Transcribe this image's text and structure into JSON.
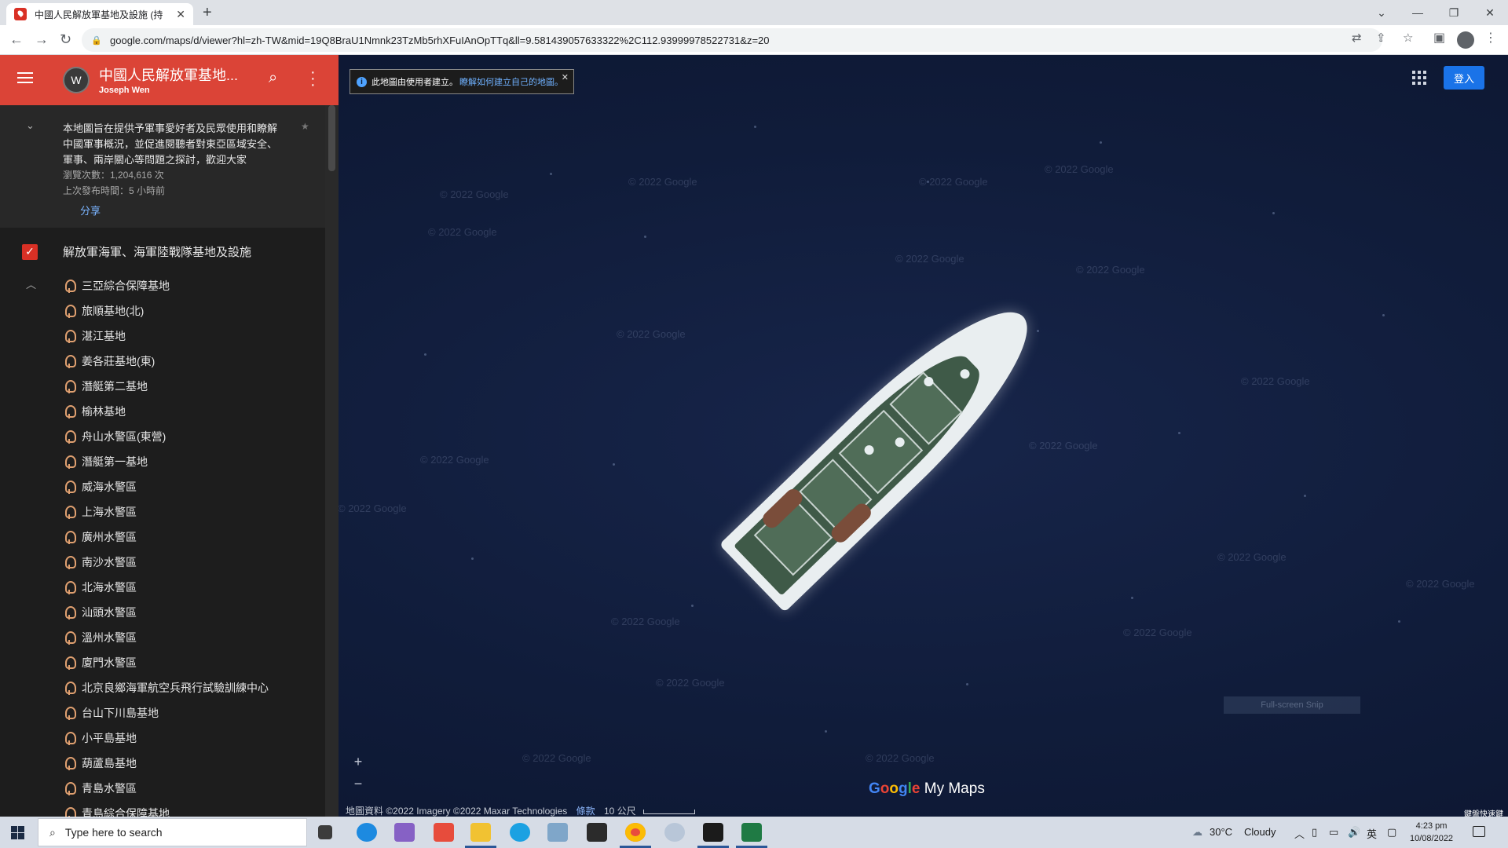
{
  "browser": {
    "tab_title": "中國人民解放軍基地及設施 (持",
    "url": "google.com/maps/d/viewer?hl=zh-TW&mid=19Q8BraU1Nmnk23TzMb5rhXFuIAnOpTTq&ll=9.581439057633322%2C112.93999978522731&z=20"
  },
  "map_header": {
    "title": "中國人民解放軍基地...",
    "author": "Joseph Wen"
  },
  "description": {
    "text": "本地圖旨在提供予軍事愛好者及民眾使用和瞭解中國軍事概況，並促進閱聽者對東亞區域安全、軍事、兩岸關心等問題之探討，歡迎大家",
    "views": "瀏覽次數：1,204,616 次",
    "last_published": "上次發布時間：5 小時前",
    "share": "分享"
  },
  "layer": {
    "name": "解放軍海軍、海軍陸戰隊基地及設施",
    "items": [
      "三亞綜合保障基地",
      "旅順基地(北)",
      "湛江基地",
      "姜各莊基地(東)",
      "潛艇第二基地",
      "榆林基地",
      "舟山水警區(東營)",
      "潛艇第一基地",
      "威海水警區",
      "上海水警區",
      "廣州水警區",
      "南沙水警區",
      "北海水警區",
      "汕頭水警區",
      "溫州水警區",
      "廈門水警區",
      "北京良鄉海軍航空兵飛行試驗訓練中心",
      "台山下川島基地",
      "小平島基地",
      "葫蘆島基地",
      "青島水警區",
      "青島綜合保障基地"
    ]
  },
  "map": {
    "notice_text": "此地圖由使用者建立。",
    "notice_link": "瞭解如何建立自己的地圖。",
    "watermark": "© 2022 Google",
    "signin": "登入",
    "zoom_in": "+",
    "zoom_out": "−",
    "logo_google": "Google",
    "logo_mymaps": "My Maps",
    "attribution": "地圖資料 ©2022 Imagery ©2022 Maxar Technologies",
    "terms": "條款",
    "scale": "10 公尺",
    "snip_label": "Full-screen Snip",
    "corner_label": "鍵盤快速鍵"
  },
  "taskbar": {
    "search_placeholder": "Type here to search",
    "temperature": "30°C",
    "weather": "Cloudy",
    "ime": "英",
    "time": "4:23 pm",
    "date": "10/08/2022"
  },
  "colors": {
    "header_red": "#db4437",
    "sidebar_bg": "#1d1d1d",
    "signin_blue": "#1a73e8",
    "map_ocean": "#101c3a"
  }
}
